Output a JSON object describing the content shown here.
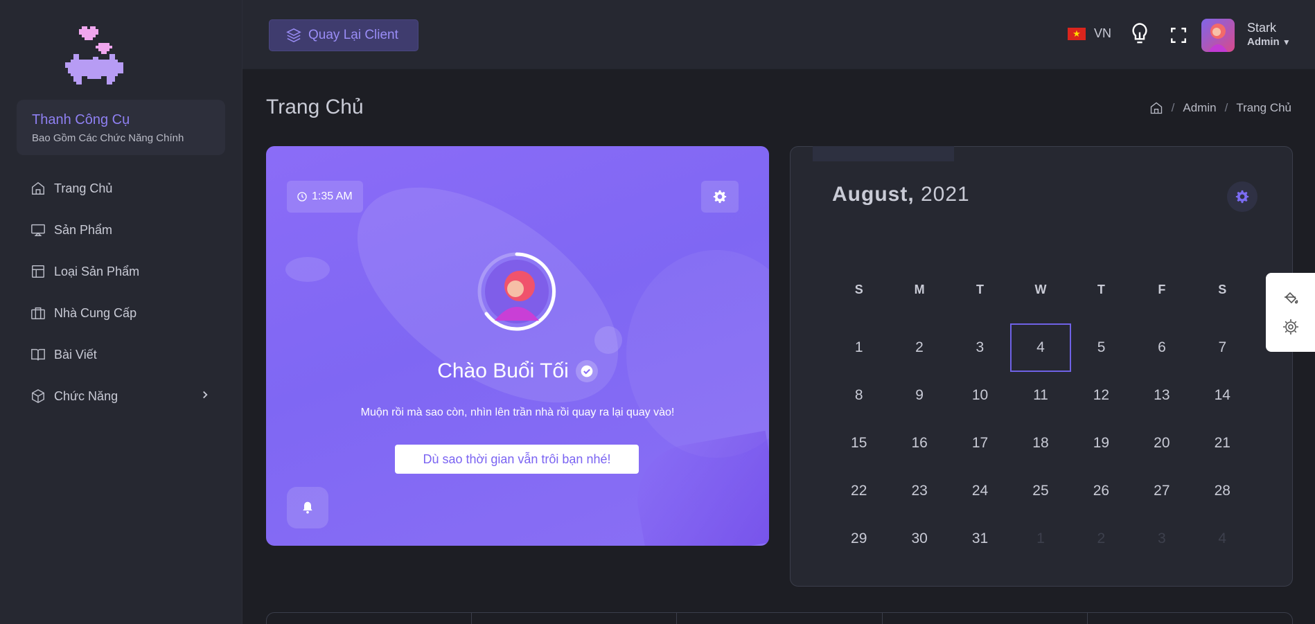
{
  "sidebar": {
    "toolbox_title": "Thanh Công Cụ",
    "toolbox_subtitle": "Bao Gồm Các Chức Năng Chính",
    "items": [
      {
        "label": "Trang Chủ",
        "icon": "home-icon"
      },
      {
        "label": "Sản Phẩm",
        "icon": "monitor-icon"
      },
      {
        "label": "Loại Sản Phẩm",
        "icon": "layout-icon"
      },
      {
        "label": "Nhà Cung Cấp",
        "icon": "briefcase-icon"
      },
      {
        "label": "Bài Viết",
        "icon": "book-open-icon"
      },
      {
        "label": "Chức Năng",
        "icon": "box-icon"
      }
    ]
  },
  "topbar": {
    "back_label": "Quay Lại Client",
    "language": "VN",
    "user_name": "Stark",
    "user_role": "Admin"
  },
  "page": {
    "title": "Trang Chủ",
    "breadcrumb": [
      "Admin",
      "Trang Chủ"
    ]
  },
  "welcome": {
    "time": "1:35 AM",
    "greeting": "Chào Buổi Tối",
    "quote": "Muộn rồi mà sao còn, nhìn lên trần nhà rồi quay ra lại quay vào!",
    "cta": "Dù sao thời gian vẫn trôi bạn nhé!"
  },
  "calendar": {
    "month": "August,",
    "year": "2021",
    "weekdays": [
      "S",
      "M",
      "T",
      "W",
      "T",
      "F",
      "S"
    ],
    "today": "4",
    "weeks": [
      [
        "1",
        "2",
        "3",
        "4",
        "5",
        "6",
        "7"
      ],
      [
        "8",
        "9",
        "10",
        "11",
        "12",
        "13",
        "14"
      ],
      [
        "15",
        "16",
        "17",
        "18",
        "19",
        "20",
        "21"
      ],
      [
        "22",
        "23",
        "24",
        "25",
        "26",
        "27",
        "28"
      ],
      [
        "29",
        "30",
        "31",
        "1",
        "2",
        "3",
        "4"
      ]
    ]
  },
  "colors": {
    "accent": "#7b6cf2",
    "sidebar_bg": "#262831",
    "page_bg": "#1d1e24",
    "card_gradient_start": "#8b6cf7"
  }
}
